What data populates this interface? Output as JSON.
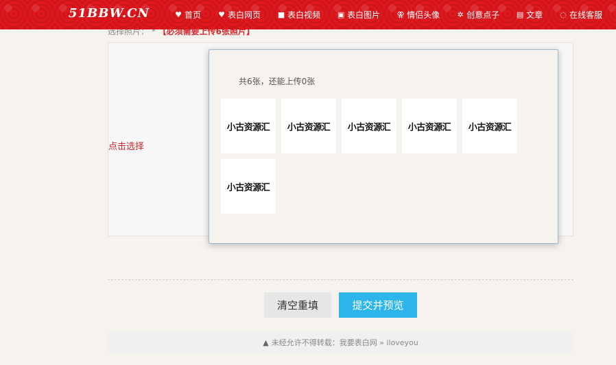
{
  "header": {
    "logo": "51BBW.CN",
    "nav": [
      {
        "icon": "heart-icon",
        "glyph": "♥",
        "label": "首页"
      },
      {
        "icon": "heart-icon",
        "glyph": "♥",
        "label": "表白网页"
      },
      {
        "icon": "video-icon",
        "glyph": "■",
        "label": "表白视频"
      },
      {
        "icon": "image-icon",
        "glyph": "▣",
        "label": "表白图片"
      },
      {
        "icon": "couple-icon",
        "glyph": "⚢",
        "label": "情侣头像"
      },
      {
        "icon": "idea-icon",
        "glyph": "✲",
        "label": "创意点子"
      },
      {
        "icon": "book-icon",
        "glyph": "▤",
        "label": "文章"
      },
      {
        "icon": "chat-icon",
        "glyph": "◌",
        "label": "在线客服"
      }
    ]
  },
  "form": {
    "choose_label": "选择照片：",
    "required_star": "*",
    "required_note": "【必须需要上传6张照片】",
    "click_select": "点击选择"
  },
  "dialog": {
    "info": "共6张，还能上传0张",
    "thumbs": [
      "小古资源汇",
      "小古资源汇",
      "小古资源汇",
      "小古资源汇",
      "小古资源汇",
      "小古资源汇"
    ]
  },
  "buttons": {
    "reset": "清空重填",
    "submit": "提交并预览"
  },
  "footer": {
    "text": "未经允许不得转载：我要表白网 » iloveyou"
  },
  "colors": {
    "header_bg": "#e0181e",
    "submit_bg": "#2db4ea",
    "accent_red": "#c8282d"
  }
}
